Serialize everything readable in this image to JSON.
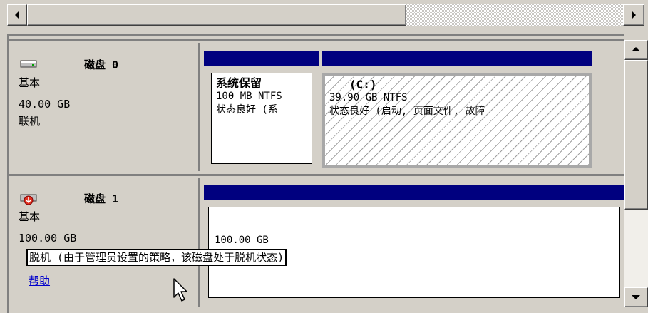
{
  "disk0": {
    "name": "磁盘 0",
    "type": "基本",
    "size": "40.00 GB",
    "status": "联机",
    "partitions": [
      {
        "title": "系统保留",
        "size_fs": "100 MB NTFS",
        "status": "状态良好 (系"
      },
      {
        "title": "(C:)",
        "size_fs": "39.90 GB NTFS",
        "status": "状态良好 (启动, 页面文件, 故障"
      }
    ]
  },
  "disk1": {
    "name": "磁盘 1",
    "type": "基本",
    "size": "100.00 GB",
    "status_tooltip": "脱机 (由于管理员设置的策略，该磁盘处于脱机状态)",
    "help_link": "帮助",
    "partition": {
      "size": "100.00 GB"
    }
  },
  "colors": {
    "partition_header": "#00007f",
    "background": "#d4d0c8",
    "link": "#0000cc"
  },
  "icons": [
    "disk-icon",
    "offline-disk-icon",
    "mouse-cursor-icon"
  ]
}
